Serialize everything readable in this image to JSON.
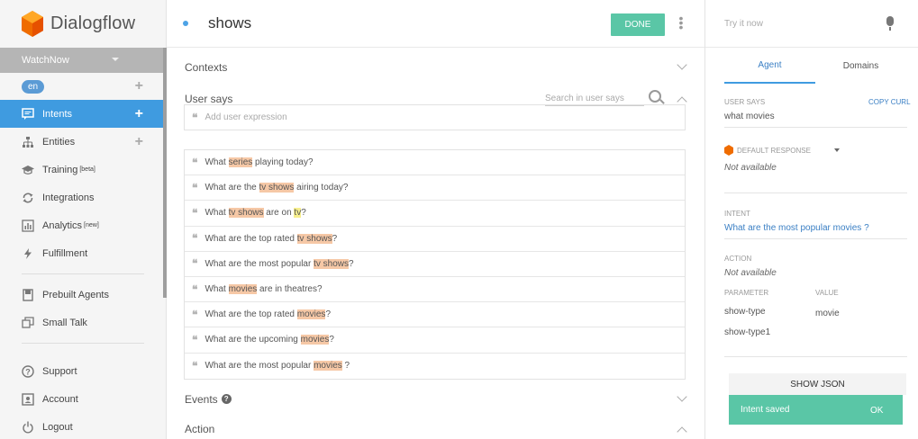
{
  "sidebar": {
    "brand": "Dialogflow",
    "agent_name": "WatchNow",
    "language": "en",
    "items": [
      {
        "label": "Intents",
        "tag": "",
        "icon": "chat-icon"
      },
      {
        "label": "Entities",
        "tag": "",
        "icon": "sitemap-icon"
      },
      {
        "label": "Training",
        "tag": "[beta]",
        "icon": "graduation-icon"
      },
      {
        "label": "Integrations",
        "tag": "",
        "icon": "sync-icon"
      },
      {
        "label": "Analytics",
        "tag": "[new]",
        "icon": "bar-chart-icon"
      },
      {
        "label": "Fulfillment",
        "tag": "",
        "icon": "bolt-icon"
      },
      {
        "label": "Prebuilt Agents",
        "tag": "",
        "icon": "book-icon"
      },
      {
        "label": "Small Talk",
        "tag": "",
        "icon": "copy-icon"
      },
      {
        "label": "Support",
        "tag": "",
        "icon": "help-icon"
      },
      {
        "label": "Account",
        "tag": "",
        "icon": "account-icon"
      },
      {
        "label": "Logout",
        "tag": "",
        "icon": "power-icon"
      }
    ],
    "colors": {
      "active": "#3f9be0",
      "agent_bar": "#b5b5b5"
    }
  },
  "header": {
    "intent_name": "shows",
    "done_label": "DONE"
  },
  "main": {
    "contexts_label": "Contexts",
    "user_says_label": "User says",
    "search_placeholder": "Search in user says",
    "add_expression_placeholder": "Add user expression",
    "phrases": [
      [
        {
          "t": "What "
        },
        {
          "t": "series",
          "h": "o"
        },
        {
          "t": " playing today?"
        }
      ],
      [
        {
          "t": "What are the "
        },
        {
          "t": "tv shows",
          "h": "o"
        },
        {
          "t": " airing today?"
        }
      ],
      [
        {
          "t": "What "
        },
        {
          "t": "tv shows",
          "h": "o"
        },
        {
          "t": " are on "
        },
        {
          "t": "tv",
          "h": "y"
        },
        {
          "t": "?"
        }
      ],
      [
        {
          "t": "What are the top rated "
        },
        {
          "t": "tv shows",
          "h": "o"
        },
        {
          "t": "?"
        }
      ],
      [
        {
          "t": "What are the most popular "
        },
        {
          "t": "tv shows",
          "h": "o"
        },
        {
          "t": "?"
        }
      ],
      [
        {
          "t": "What "
        },
        {
          "t": "movies",
          "h": "o"
        },
        {
          "t": " are in theatres?"
        }
      ],
      [
        {
          "t": "What are the top rated "
        },
        {
          "t": "movies",
          "h": "o"
        },
        {
          "t": "?"
        }
      ],
      [
        {
          "t": "What are the upcoming "
        },
        {
          "t": "movies",
          "h": "o"
        },
        {
          "t": "?"
        }
      ],
      [
        {
          "t": "What are the most popular "
        },
        {
          "t": "movies",
          "h": "o"
        },
        {
          "t": " ?"
        }
      ]
    ],
    "events_label": "Events",
    "action_label": "Action",
    "colors": {
      "highlight_entity": "#f6c8a6",
      "highlight_alt": "#f7ef8d",
      "done": "#5ac6a6"
    }
  },
  "right": {
    "try_placeholder": "Try it now",
    "tabs": [
      "Agent",
      "Domains"
    ],
    "user_says_label": "USER SAYS",
    "copy_curl": "COPY CURL",
    "user_says_value": "what movies",
    "default_response_label": "DEFAULT RESPONSE",
    "default_response_value": "Not available",
    "intent_label": "INTENT",
    "intent_value": "What are the most popular movies ?",
    "action_label": "ACTION",
    "action_value": "Not available",
    "parameter_label": "PARAMETER",
    "value_label": "VALUE",
    "params": [
      {
        "name": "show-type",
        "value": "movie"
      },
      {
        "name": "show-type1",
        "value": ""
      }
    ],
    "show_json": "SHOW JSON",
    "toast_text": "Intent saved",
    "toast_ok": "OK"
  }
}
